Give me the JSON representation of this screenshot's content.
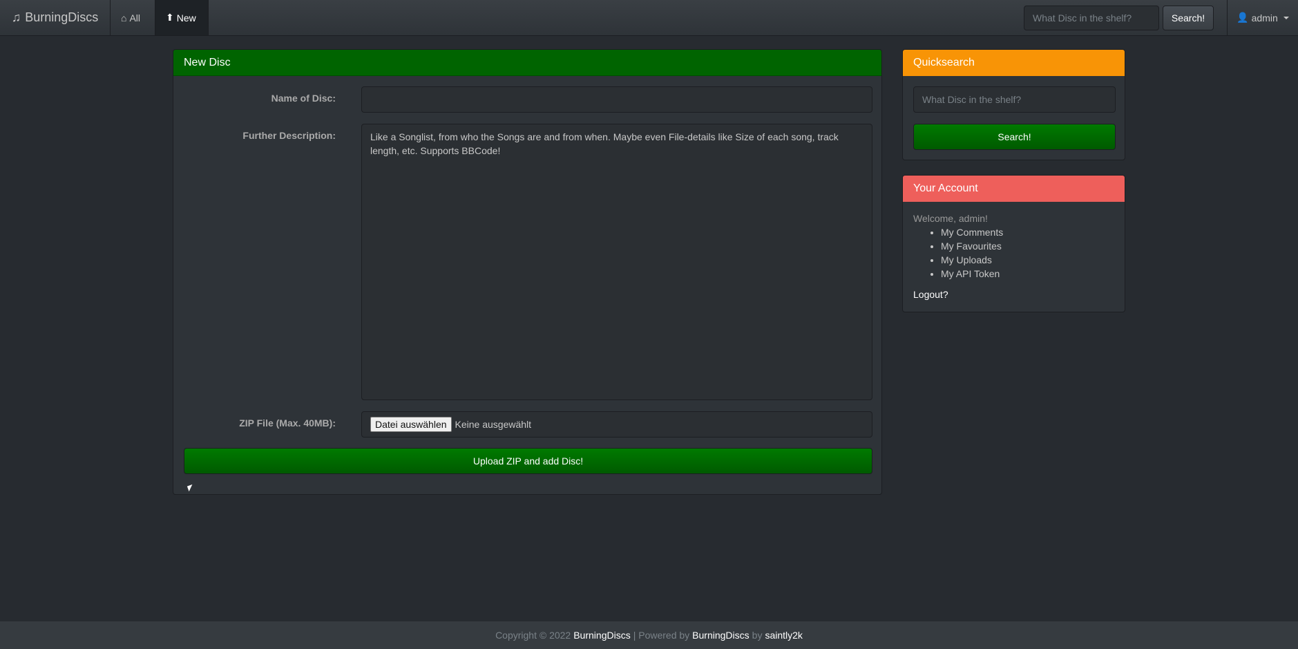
{
  "navbar": {
    "brand": "BurningDiscs",
    "all_label": "All",
    "new_label": "New",
    "search_placeholder": "What Disc in the shelf?",
    "search_button": "Search!",
    "user_label": "admin"
  },
  "form": {
    "title": "New Disc",
    "name_label": "Name of Disc:",
    "name_value": "",
    "description_label": "Further Description:",
    "description_placeholder": "Like a Songlist, from who the Songs are and from when. Maybe even File-details like Size of each song, track length, etc. Supports BBCode!",
    "zip_label": "ZIP File (Max. 40MB):",
    "file_button": "Datei auswählen",
    "file_status": "Keine ausgewählt",
    "submit_button": "Upload ZIP and add Disc!"
  },
  "quicksearch": {
    "title": "Quicksearch",
    "placeholder": "What Disc in the shelf?",
    "button": "Search!"
  },
  "account": {
    "title": "Your Account",
    "welcome": "Welcome, admin!",
    "links": [
      "My Comments",
      "My Favourites",
      "My Uploads",
      "My API Token"
    ],
    "logout": "Logout?"
  },
  "footer": {
    "copyright": "Copyright © 2022",
    "site": "BurningDiscs",
    "sep": "| Powered by",
    "powered": "BurningDiscs",
    "by": "by",
    "author": "saintly2k"
  },
  "colors": {
    "background": "#272b30",
    "success": "#006400",
    "warning": "#f89406",
    "danger": "#ee5f5b"
  }
}
